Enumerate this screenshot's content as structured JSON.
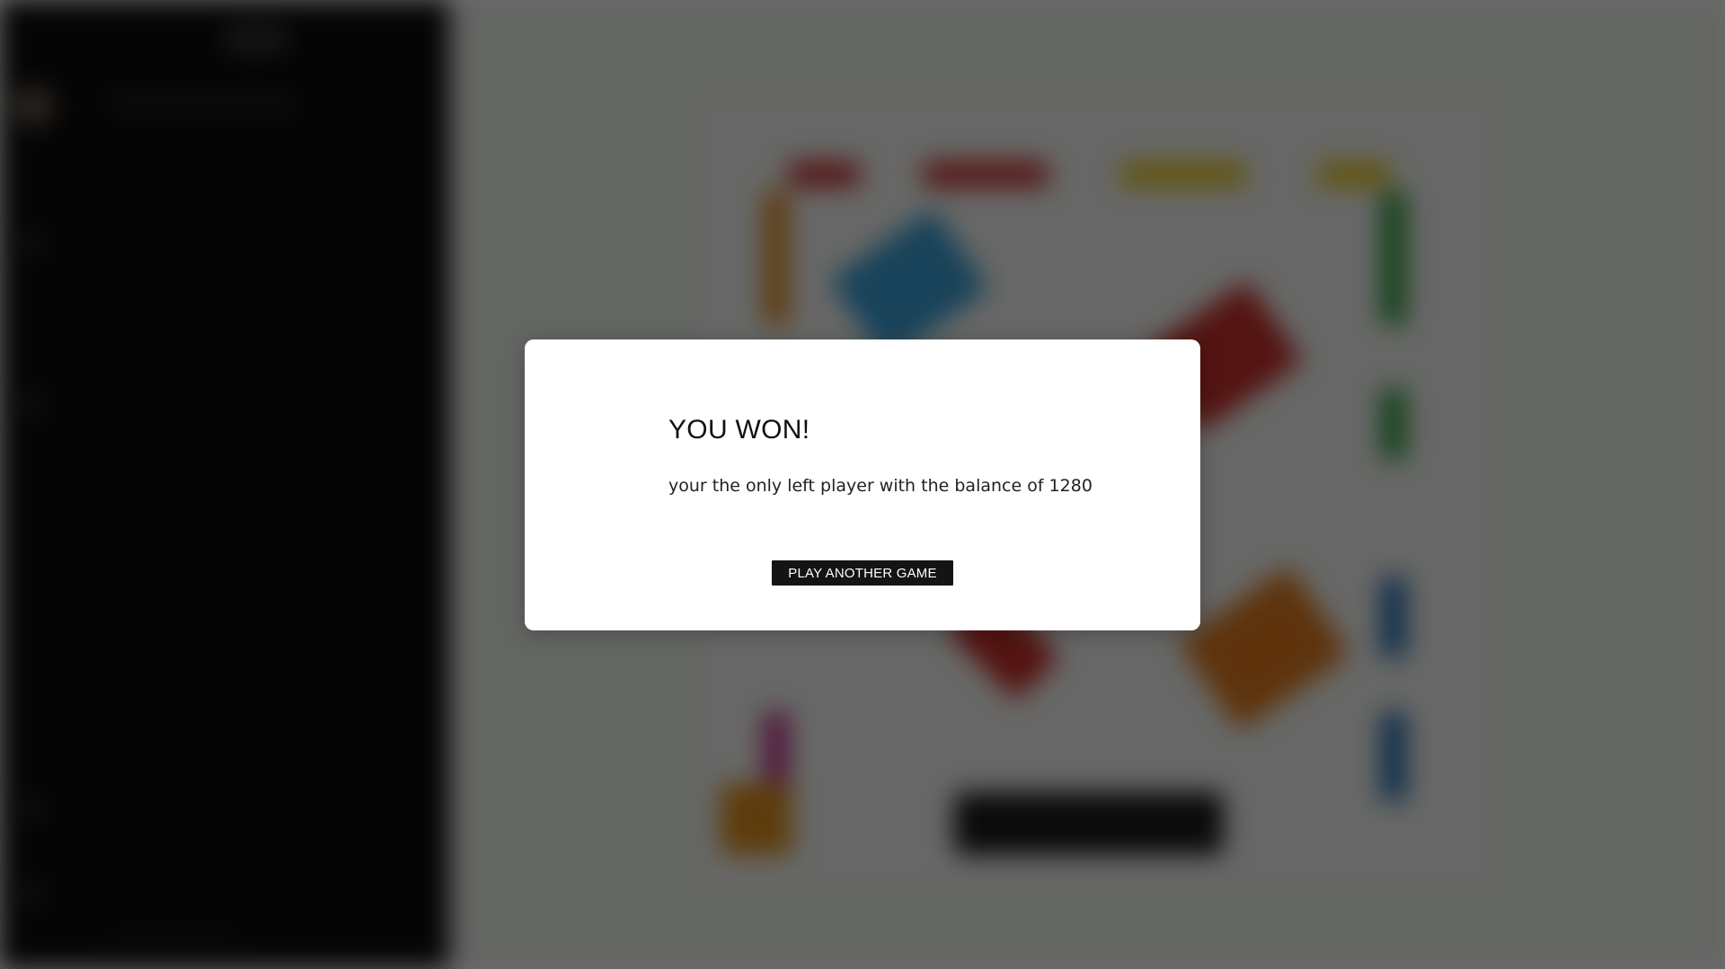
{
  "modal": {
    "title": "YOU WON!",
    "message": "your the only left player with the balance of 1280",
    "button_label": "PLAY ANOTHER GAME"
  },
  "colors": {
    "sidebar_bg": "#0c0c0c",
    "board_bg": "#eef2ec",
    "overlay": "rgba(0,0,0,0.58)",
    "modal_bg": "#ffffff",
    "button_bg": "#141414",
    "button_text": "#ffffff",
    "text": "#111111"
  }
}
